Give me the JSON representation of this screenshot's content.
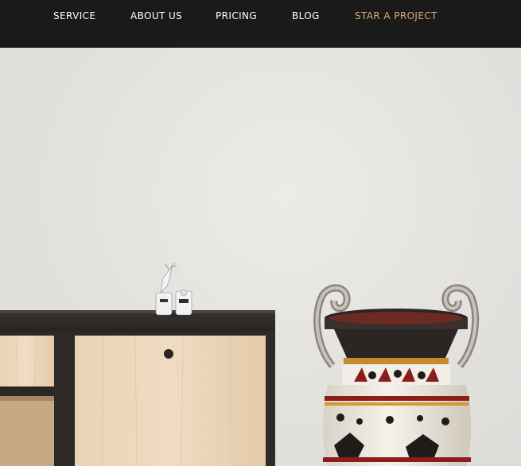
{
  "nav": {
    "items": [
      {
        "label": "SERVICE"
      },
      {
        "label": "ABOUT US"
      },
      {
        "label": "PRICING"
      },
      {
        "label": "BLOG"
      },
      {
        "label": "STAR A PROJECT"
      }
    ]
  },
  "colors": {
    "nav_background": "#1a1a1a",
    "nav_text": "#ffffff",
    "nav_accent": "#d8ad7b",
    "wall": "#e6e4e0"
  },
  "hero": {
    "image": "interior-sideboard-with-greek-vase-photo"
  }
}
